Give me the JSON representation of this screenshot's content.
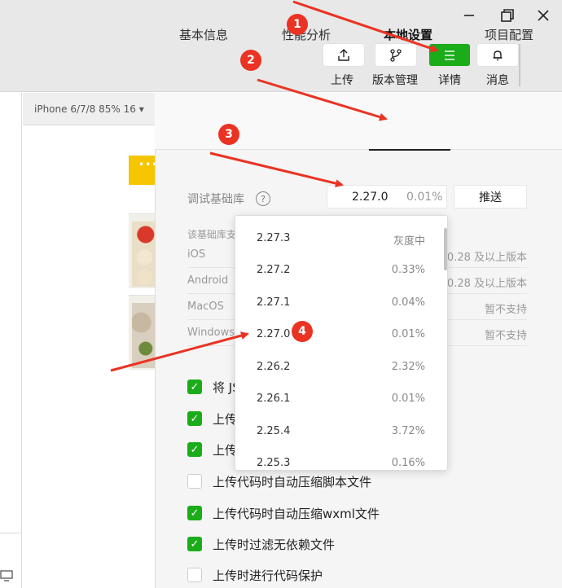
{
  "toolbar": {
    "upload_label": "上传",
    "version_label": "版本管理",
    "details_label": "详情",
    "messages_label": "消息",
    "accent_color": "#1aad19"
  },
  "simulator": {
    "device_label": "iPhone 6/7/8 85% 16 ▾",
    "dots": "•••"
  },
  "tabs": [
    {
      "label": "基本信息"
    },
    {
      "label": "性能分析"
    },
    {
      "label": "本地设置"
    },
    {
      "label": "项目配置"
    }
  ],
  "debug_lib": {
    "label": "调试基础库",
    "help": "?",
    "version": "2.27.0",
    "percent": "0.01%",
    "push_label": "推送",
    "hint": "该基础库支持"
  },
  "platforms": [
    {
      "name": "iOS",
      "value": "0.28 及以上版本"
    },
    {
      "name": "Android",
      "value": "0.28 及以上版本"
    },
    {
      "name": "MacOS",
      "value": "暂不支持"
    },
    {
      "name": "Windows",
      "value": "暂不支持"
    }
  ],
  "dropdown": [
    {
      "version": "2.27.3",
      "percent": "灰度中"
    },
    {
      "version": "2.27.2",
      "percent": "0.33%"
    },
    {
      "version": "2.27.1",
      "percent": "0.04%"
    },
    {
      "version": "2.27.0",
      "percent": "0.01%"
    },
    {
      "version": "2.26.2",
      "percent": "2.32%"
    },
    {
      "version": "2.26.1",
      "percent": "0.01%"
    },
    {
      "version": "2.25.4",
      "percent": "3.72%"
    },
    {
      "version": "2.25.3",
      "percent": "0.16%"
    }
  ],
  "checkboxes": [
    {
      "label": "将 JS",
      "checked": true
    },
    {
      "label": "上传",
      "checked": true
    },
    {
      "label": "上传",
      "checked": true
    },
    {
      "label": "上传代码时自动压缩脚本文件",
      "checked": false
    },
    {
      "label": "上传代码时自动压缩wxml文件",
      "checked": true
    },
    {
      "label": "上传时过滤无依赖文件",
      "checked": true
    },
    {
      "label": "上传时进行代码保护",
      "checked": false
    }
  ],
  "annotations": [
    "1",
    "2",
    "3",
    "4"
  ]
}
